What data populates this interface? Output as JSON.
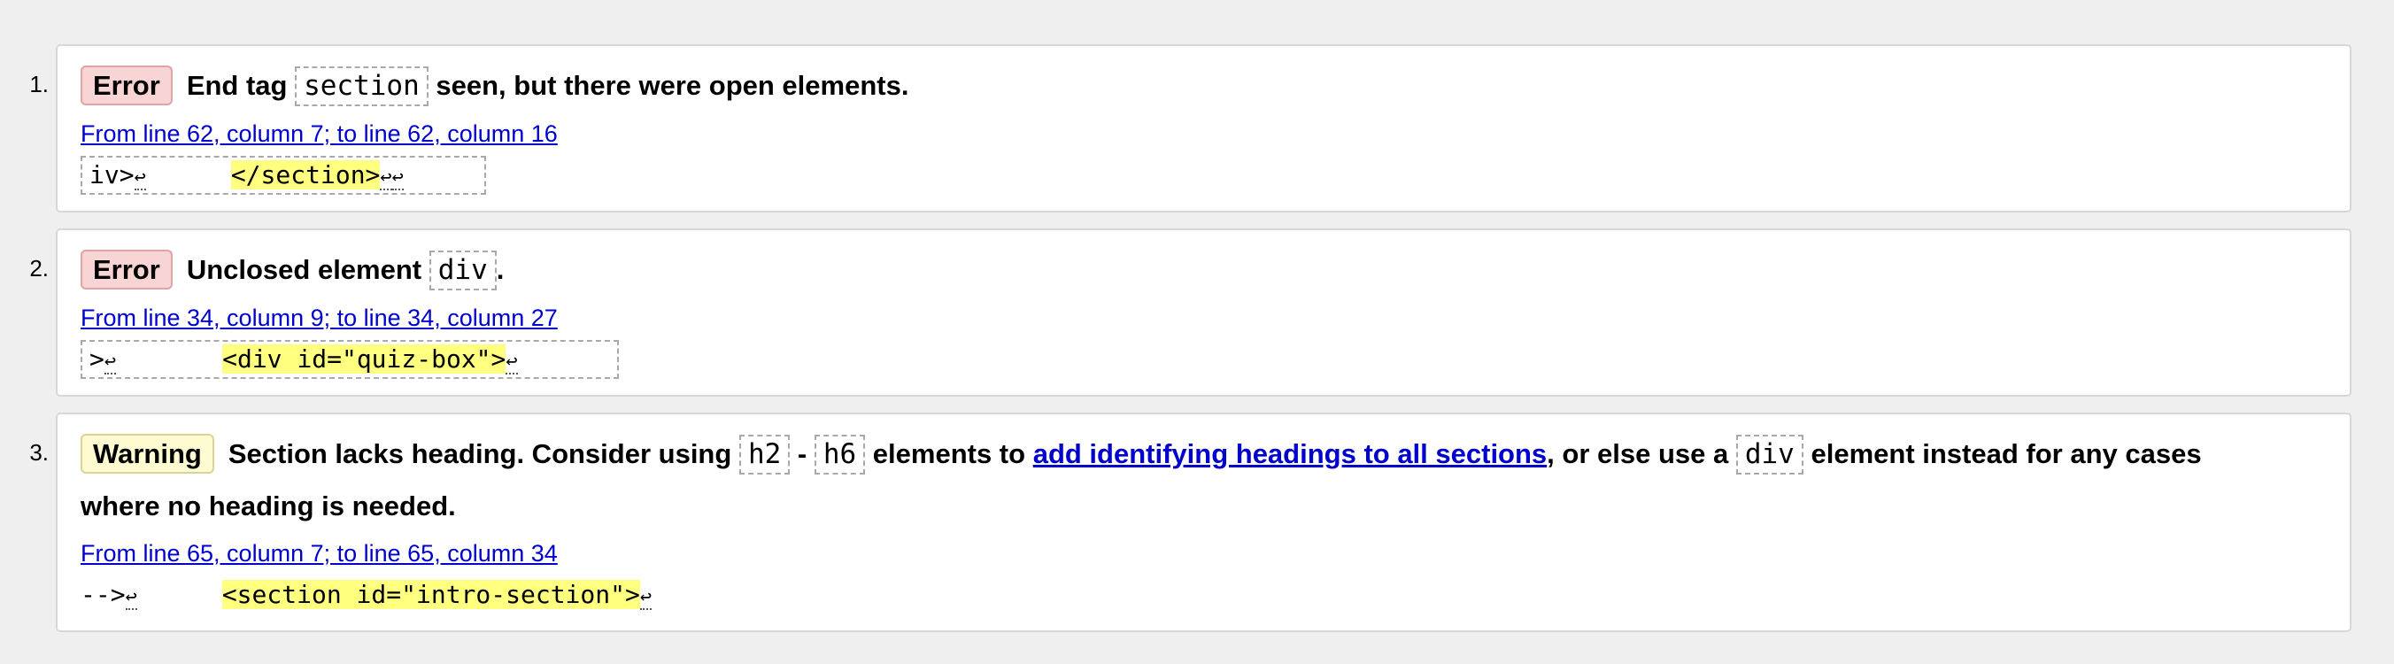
{
  "results": [
    {
      "number": "1.",
      "type": "Error",
      "message_prefix": "End tag",
      "message_code": "section",
      "message_suffix": "seen, but there were open elements.",
      "location": "From line 62, column 7; to line 62, column 16",
      "extract_pre": "iv>",
      "extract_highlight": "</section>"
    },
    {
      "number": "2.",
      "type": "Error",
      "message_prefix": "Unclosed element",
      "message_code": "div",
      "message_suffix": ".",
      "location": "From line 34, column 9; to line 34, column 27",
      "extract_pre": ">",
      "extract_highlight": "<div id=\"quiz-box\">"
    },
    {
      "number": "3.",
      "type": "Warning",
      "message_prefix": "Section lacks heading. Consider using",
      "message_code_a": "h2",
      "message_dash": "-",
      "message_code_b": "h6",
      "message_mid": "elements to",
      "message_link": "add identifying headings to all sections",
      "message_after_link": ", or else use a",
      "message_code_c": "div",
      "message_suffix": "element instead for any cases",
      "message_line2": "where no heading is needed.",
      "location": "From line 65, column 7; to line 65, column 34",
      "extract_pre": "-->",
      "extract_highlight": "<section id=\"intro-section\">"
    }
  ],
  "return_glyph": "↩",
  "colors": {
    "error_badge_bg": "#f8d4d4",
    "warning_badge_bg": "#fdfbcf",
    "highlight": "#ffff80",
    "link": "#0000cc"
  }
}
